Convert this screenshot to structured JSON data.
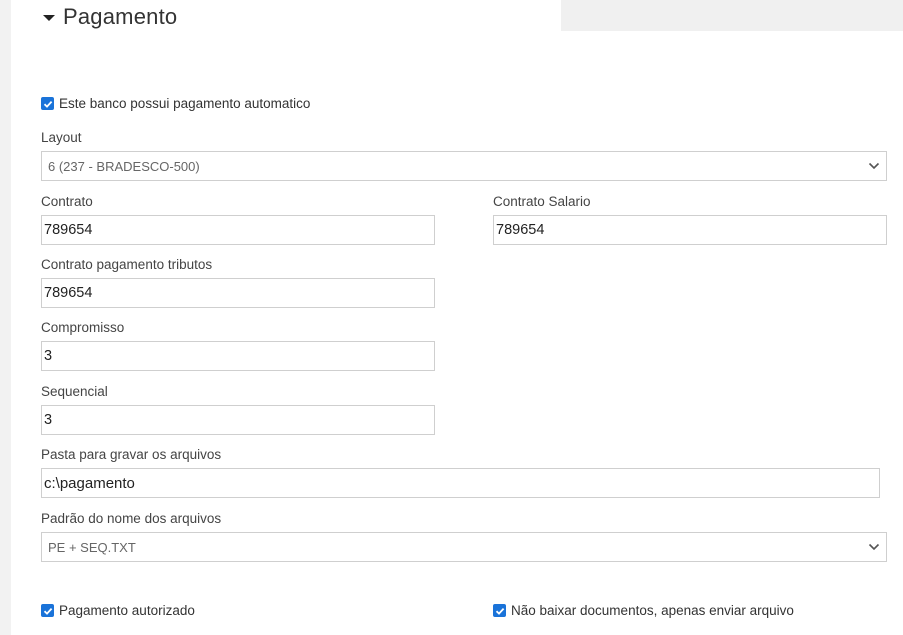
{
  "section": {
    "title": "Pagamento"
  },
  "auto_payment": {
    "label": "Este banco possui pagamento automatico",
    "checked": true
  },
  "layout": {
    "label": "Layout",
    "value": "6 (237 - BRADESCO-500)"
  },
  "contrato": {
    "label": "Contrato",
    "value": "789654"
  },
  "contrato_salario": {
    "label": "Contrato Salario",
    "value": "789654"
  },
  "contrato_tributos": {
    "label": "Contrato pagamento tributos",
    "value": "789654"
  },
  "compromisso": {
    "label": "Compromisso",
    "value": "3"
  },
  "sequencial": {
    "label": "Sequencial",
    "value": "3"
  },
  "pasta": {
    "label": "Pasta para gravar os arquivos",
    "value": "c:\\pagamento"
  },
  "padrao_nome": {
    "label": "Padrão do nome dos arquivos",
    "value": "PE + SEQ.TXT"
  },
  "pagamento_autorizado": {
    "label": "Pagamento autorizado",
    "checked": true
  },
  "nao_baixar": {
    "label": "Não baixar documentos, apenas enviar arquivo",
    "checked": true
  },
  "colors": {
    "accent": "#1a73d9",
    "border": "#cfcfcf",
    "background": "#f2f2f2"
  }
}
